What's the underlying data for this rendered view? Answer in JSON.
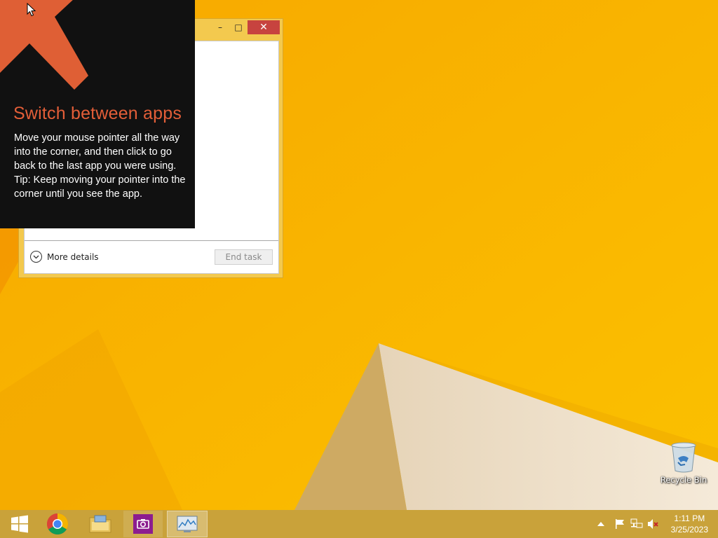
{
  "tip": {
    "title": "Switch between apps",
    "body_line1": "Move your mouse pointer all the way into the corner, and then click to go back to the last app you were using.",
    "body_line2": "Tip: Keep moving your pointer into the corner until you see the app.",
    "accent_color": "#e35e38"
  },
  "task_manager": {
    "minimize_icon": "minimize-icon",
    "maximize_icon": "maximize-icon",
    "close_icon": "close-icon",
    "more_details_label": "More details",
    "end_task_label": "End task"
  },
  "desktop": {
    "recycle_bin_label": "Recycle Bin",
    "wallpaper_color": "#f6b400"
  },
  "taskbar": {
    "items": [
      {
        "name": "start-button",
        "icon": "windows-logo-icon"
      },
      {
        "name": "chrome",
        "icon": "chrome-icon"
      },
      {
        "name": "file-explorer",
        "icon": "folder-icon"
      },
      {
        "name": "camera-app",
        "icon": "camera-icon"
      },
      {
        "name": "task-manager",
        "icon": "task-manager-icon",
        "active": true
      }
    ],
    "tray_icons": [
      "chevron-up-icon",
      "flag-icon",
      "network-icon",
      "volume-muted-icon"
    ],
    "time": "1:11 PM",
    "date": "3/25/2023"
  }
}
